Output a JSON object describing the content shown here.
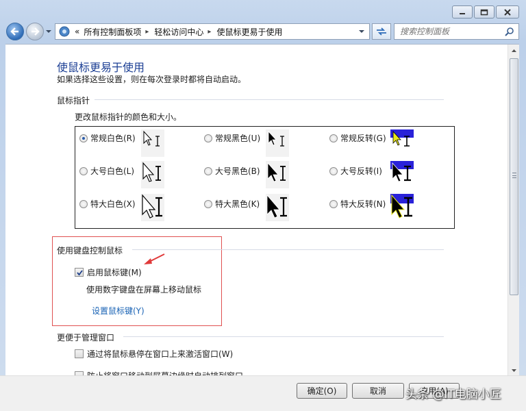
{
  "window": {
    "controls": [
      "minimize",
      "maximize",
      "close"
    ]
  },
  "nav": {
    "breadcrumbs": [
      "«",
      "所有控制面板项",
      "轻松访问中心",
      "使鼠标更易于使用"
    ],
    "search_placeholder": "搜索控制面板"
  },
  "page": {
    "title": "使鼠标更易于使用",
    "subtitle": "如果选择这些设置，则在每次登录时都将自动启动。"
  },
  "pointers": {
    "section": "鼠标指针",
    "description": "更改鼠标指针的颜色和大小。",
    "options": [
      {
        "label": "常规白色(R)",
        "checked": true,
        "style": "white",
        "size": "regular"
      },
      {
        "label": "常规黑色(U)",
        "checked": false,
        "style": "black",
        "size": "regular"
      },
      {
        "label": "常规反转(G)",
        "checked": false,
        "style": "inverted",
        "size": "regular"
      },
      {
        "label": "大号白色(L)",
        "checked": false,
        "style": "white",
        "size": "large"
      },
      {
        "label": "大号黑色(B)",
        "checked": false,
        "style": "black",
        "size": "large"
      },
      {
        "label": "大号反转(I)",
        "checked": false,
        "style": "inverted",
        "size": "large"
      },
      {
        "label": "特大白色(X)",
        "checked": false,
        "style": "white",
        "size": "extra-large"
      },
      {
        "label": "特大黑色(K)",
        "checked": false,
        "style": "black",
        "size": "extra-large"
      },
      {
        "label": "特大反转(N)",
        "checked": false,
        "style": "inverted",
        "size": "extra-large"
      }
    ]
  },
  "keyboard": {
    "section": "使用键盘控制鼠标",
    "mouse_keys_label": "启用鼠标键(M)",
    "mouse_keys_checked": true,
    "mouse_keys_desc": "使用数字键盘在屏幕上移动鼠标",
    "setup_link": "设置鼠标键(Y)"
  },
  "windows_mgmt": {
    "section": "更便于管理窗口",
    "hover_activate_label": "通过将鼠标悬停在窗口上来激活窗口(W)",
    "hover_activate_checked": false,
    "prevent_arrange_label": "防止将窗口移动到屏幕边缘时自动排列窗口",
    "prevent_arrange_checked": false
  },
  "footer": {
    "ok": "确定(O)",
    "cancel": "取消",
    "apply": "应用(A)",
    "watermark": "头条 @IT电脑小匠"
  },
  "colors": {
    "title": "#1c3f94",
    "link": "#1a63b5",
    "highlight": "#e05050",
    "inverted": "#2a22d9"
  }
}
